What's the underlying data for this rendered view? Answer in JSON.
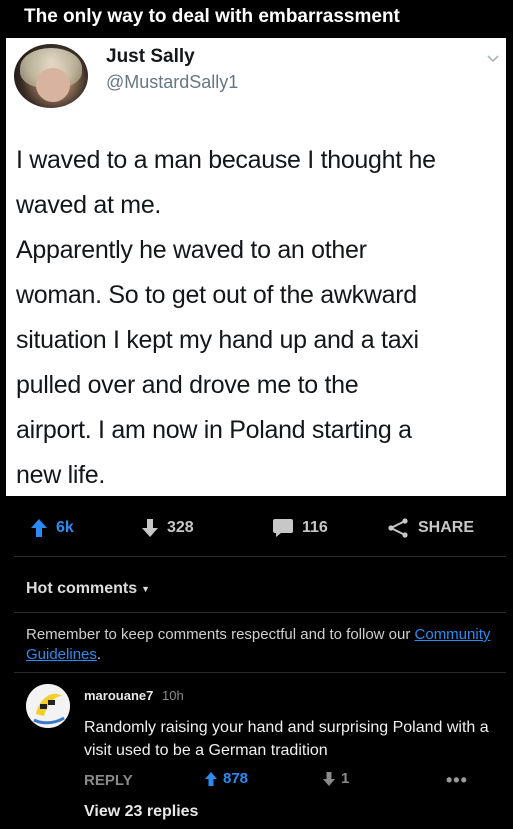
{
  "post": {
    "title": "The only way to deal with embarrassment"
  },
  "tweet": {
    "name": "Just Sally",
    "handle": "@MustardSally1",
    "lines": [
      "I waved to a man because I thought he",
      "waved at me.",
      "Apparently he waved to an other",
      "woman. So to get out of the awkward",
      "situation I kept my hand up and a taxi",
      "pulled over and drove me to the",
      "airport. I am now in Poland starting a",
      "new life."
    ]
  },
  "actions": {
    "upvotes": "6k",
    "downvotes": "328",
    "comments": "116",
    "share_label": "SHARE",
    "upvote_color": "#2a8bf2"
  },
  "comments_section": {
    "sort_label": "Hot comments",
    "notice_text": "Remember to keep comments respectful and to follow our ",
    "notice_link": "Community Guidelines",
    "notice_end": "."
  },
  "comment": {
    "username": "marouane7",
    "time": "10h",
    "text": "Randomly raising your hand and surprising Poland with a visit used to be a German tradition",
    "reply_label": "REPLY",
    "upvotes": "878",
    "downvotes": "1",
    "more_label": "•••",
    "view_replies": "View 23 replies"
  }
}
